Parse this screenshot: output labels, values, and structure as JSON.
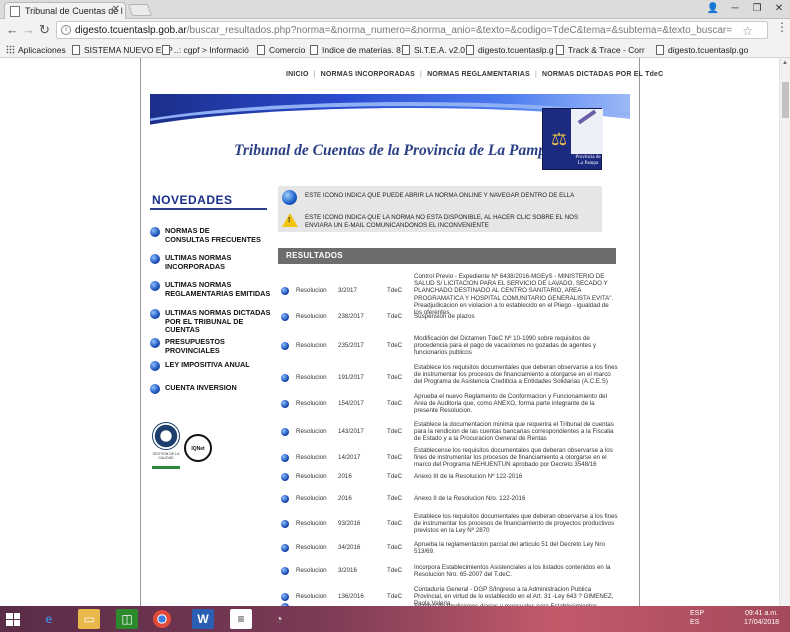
{
  "browser": {
    "tab_title": "Tribunal de Cuentas de l",
    "url_host": "digesto.tcuentaslp.gob.ar",
    "url_path": "/buscar_resultados.php?norma=&norma_numero=&norma_anio=&texto=&codigo=TdeC&tema=&subtema=&texto_buscar=",
    "bookmarks": [
      "Aplicaciones",
      "SISTEMA NUEVO EXP",
      "..: cgpf > Informació",
      "Comercio",
      "Indice de materias. 8",
      "Si.T.E.A. v2.0",
      "digesto.tcuentaslp.g",
      "Track & Trace - Corr",
      "digesto.tcuentaslp.go"
    ]
  },
  "topnav": [
    "INICIO",
    "NORMAS INCORPORADAS",
    "NORMAS REGLAMENTARIAS",
    "NORMAS DICTADAS POR EL TdeC"
  ],
  "banner": {
    "title": "Tribunal de Cuentas de la Provincia de La Pampa",
    "seal_text": "Provincia de La Pampa"
  },
  "sidebar": {
    "title": "NOVEDADES",
    "items": [
      {
        "l1": "NORMAS DE",
        "l2": "CONSULTAS FRECUENTES"
      },
      {
        "l1": "ULTIMAS NORMAS",
        "l2": "INCORPORADAS"
      },
      {
        "l1": "ULTIMAS NORMAS",
        "l2": "REGLAMENTARIAS EMITIDAS"
      },
      {
        "l1": "ULTIMAS NORMAS DICTADAS",
        "l2": "POR EL TRIBUNAL DE CUENTAS"
      },
      {
        "l1": "PRESUPUESTOS PROVINCIALES",
        "l2": ""
      },
      {
        "l1": "LEY IMPOSITIVA ANUAL",
        "l2": ""
      },
      {
        "l1": "CUENTA INVERSION",
        "l2": ""
      }
    ],
    "logo_caption": "GESTION DE LA CALIDAD",
    "logo2": "IQNet"
  },
  "notices": {
    "online": "ESTE ICONO INDICA QUE PUEDE ABRIR LA NORMA ONLINE Y NAVEGAR DENTRO DE ELLA",
    "unavailable": "ESTE ICONO INDICA QUE LA NORMA NO ESTA DISPONIBLE, AL HACER CLIC SOBRE EL NOS  ENVIARA  UN E-MAIL COMUNICANDONOS EL INCONVENIENTE"
  },
  "results": {
    "header": "RESULTADOS",
    "rows": [
      {
        "tipo": "Resolucion",
        "numero": "3/2017",
        "codigo": "TdeC",
        "desc": "Control Previo - Expediente Nº 6438/2016-MGEyS - MINISTERIO DE SALUD S/ LICITACION PARA EL SERVICIO DE LAVADO, SECADO Y PLANCHADO DESTINADO AL CENTRO SANITARIO, AREA PROGRAMATICA Y HOSPITAL COMUNITARIO GENERALISTA EVITA\". Preadjudicacion en violacion a lo establecido en el Pliego - igualdad de los oferentes"
      },
      {
        "tipo": "Resolucion",
        "numero": "238/2017",
        "codigo": "TdeC",
        "desc": "Suspension de plazos"
      },
      {
        "tipo": "Resolucion",
        "numero": "235/2017",
        "codigo": "TdeC",
        "desc": "Modificación del Dictamen TdeC Nº 10-1990 sobre requisitos de procedencia para el pago de vacaciones no gozadas de agentes y funcionarios publicos"
      },
      {
        "tipo": "Resolucion",
        "numero": "191/2017",
        "codigo": "TdeC",
        "desc": "Establece los requisitos documentales que deberan observarse a los fines de instrumentar los procesos de financiamiento a otorgarse en el marco del Programa de Asistencia Crediticia a Entidades Solidarias (A.C.E.S)"
      },
      {
        "tipo": "Resolucion",
        "numero": "154/2017",
        "codigo": "TdeC",
        "desc": "Aprueba el nuevo Reglamento de Conformacion y Funcionamiento del Area de Auditoria que, como ANEXO, forma parte integrante de la presente Resolucion."
      },
      {
        "tipo": "Resolucion",
        "numero": "143/2017",
        "codigo": "TdeC",
        "desc": "Establece la documentacion minima que requerira el Tribunal de cuentas para la rendicion de las cuentas bancarias correspondientes a la Fiscalia de Estado y a la Procuracion General de Rentas"
      },
      {
        "tipo": "Resolucion",
        "numero": "14/2017",
        "codigo": "TdeC",
        "desc": "Establecense los requisitos documentales que deberan observarse a los fines de instrumentar los procesos de financiamiento a otorgarse en el marco del Programa NEHUENTUN aprobado por Decreto 3548/16"
      },
      {
        "tipo": "Resolucion",
        "numero": "2016",
        "codigo": "TdeC",
        "desc": "Anexo III de la Resolucion Nº 122-2016"
      },
      {
        "tipo": "Resolucion",
        "numero": "2016",
        "codigo": "TdeC",
        "desc": "Anexo II de la Resolucion Nro. 122-2016"
      },
      {
        "tipo": "Resolucion",
        "numero": "93/2016",
        "codigo": "TdeC",
        "desc": "Establece los requisitos documentales que deberan observarse a los fines de instrumentar los procesos de financiamiento de proyectos productivos previstos en la Ley Nº 2870"
      },
      {
        "tipo": "Resolucion",
        "numero": "34/2016",
        "codigo": "TdeC",
        "desc": "Aprueba la reglamentacion parcial del articulo 51 del Decreto Ley Nro 513/69."
      },
      {
        "tipo": "Resolucion",
        "numero": "3/2016",
        "codigo": "TdeC",
        "desc": "Incorpora Establecimientos Asistenciales a los listados contenidos en la Resolucion Nro. 65-2007 del T.deC."
      },
      {
        "tipo": "Resolucion",
        "numero": "136/2016",
        "codigo": "TdeC",
        "desc": "Contaduría General - DGP S/Ingreso a la Administracion Publica Provincial, en virtud de lo establecido en el Art. 31 -Ley 643 ? GIMENEZ, Paola Valeria."
      },
      {
        "tipo": "",
        "numero": "",
        "codigo": "",
        "desc": "Sistema de rendiciones diarias y mensuales para Establecimientos"
      }
    ]
  },
  "taskbar": {
    "lang1": "ESP",
    "lang2": "ES",
    "time": "09:41 a.m.",
    "date": "17/04/2018"
  }
}
